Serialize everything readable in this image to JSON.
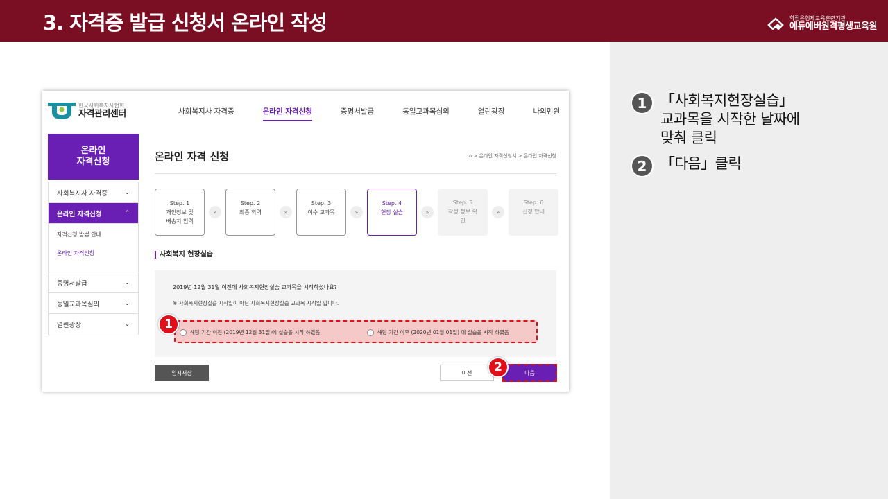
{
  "header": {
    "title": "3. 자격증 발급 신청서 온라인 작성",
    "brand_sub": "학점은행제교육훈련기관",
    "brand_main": "에듀에버원격평생교육원",
    "bg_color": "#7a0e23"
  },
  "instructions": [
    {
      "num": "1",
      "text_lines": [
        "「사회복지현장실습」",
        "교과목을 시작한 날짜에",
        "맞춰 클릭"
      ]
    },
    {
      "num": "2",
      "text_lines": [
        "「다음」클릭"
      ]
    }
  ],
  "site": {
    "logo_top": "한국사회복지사협회",
    "logo_bottom": "자격관리센터",
    "nav": [
      "사회복지사 자격증",
      "온라인 자격신청",
      "증명서발급",
      "동일교과목심의",
      "열린광장",
      "나의민원"
    ],
    "nav_active": 1,
    "accent": "#6a1fb4"
  },
  "sidebar": {
    "banner_line1": "온라인",
    "banner_line2": "자격신청",
    "items": [
      {
        "label": "사회복지사 자격증",
        "chev": "⌄"
      },
      {
        "label": "온라인 자격신청",
        "chev": "⌃"
      }
    ],
    "sub_items": [
      "자격신청 방법 안내",
      "온라인 자격신청"
    ],
    "items_after": [
      {
        "label": "증명서발급",
        "chev": "⌄"
      },
      {
        "label": "동일교과목심의",
        "chev": "⌄"
      },
      {
        "label": "열린광장",
        "chev": "⌄"
      }
    ]
  },
  "main": {
    "title": "온라인 자격 신청",
    "breadcrumb": "⌂ > 온라인 자격신청서 > 온라인 자격신청",
    "steps": [
      {
        "step": "Step. 1",
        "label1": "개인정보 및",
        "label2": "배송지 입력"
      },
      {
        "step": "Step. 2",
        "label1": "최종 학력",
        "label2": ""
      },
      {
        "step": "Step. 3",
        "label1": "이수 교과목",
        "label2": ""
      },
      {
        "step": "Step. 4",
        "label1": "현장 실습",
        "label2": ""
      },
      {
        "step": "Step. 5",
        "label1": "작성 정보 확",
        "label2": "인"
      },
      {
        "step": "Step. 6",
        "label1": "신청 안내",
        "label2": ""
      }
    ],
    "current_step": 3,
    "section_title": "사회복지 현장실습",
    "question": "2019년 12월 31일 이전에 사회복지현장실습 교과목을 시작하셨나요?",
    "note": "※ 사회복지현장실습 시작일이 아닌 사회복지현장실습 교과목 시작일 입니다.",
    "option1": "해당 기간 이전 (2019년 12월 31일)에 실습을 시작 하였음",
    "option2": "해당 기간 이후 (2020년 01월 01일) 에 실습을 시작 하였음",
    "btn_temp": "임시저장",
    "btn_prev": "이전",
    "btn_next": "다음"
  },
  "callouts": [
    "1",
    "2"
  ]
}
